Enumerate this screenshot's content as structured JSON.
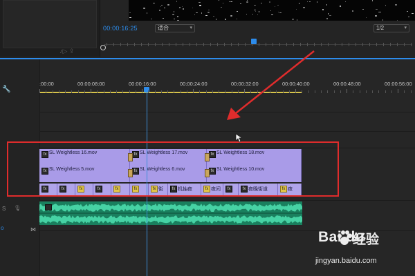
{
  "monitor": {
    "timecode": "00:00:16:25",
    "fit_label": "适合",
    "resolution_label": "1/2"
  },
  "timeline": {
    "ruler_labels": [
      ":00:00",
      "00:00:08:00",
      "00:00:16:00",
      "00:00:24:00",
      "00:00:32:00",
      "00:00:40:00",
      "00:00:48:00",
      "00:00:56:00"
    ],
    "track_label_s": "S",
    "track_label_o": "o"
  },
  "clips": {
    "v2": [
      {
        "name": "SL Weightless 16.mov"
      },
      {
        "name": "SL Weightless 17.mov"
      },
      {
        "name": "SL Weightless 18.mov"
      }
    ],
    "v1": [
      {
        "name": "SL Weightless 5.mov"
      },
      {
        "name": "SL Weightless 6.mov"
      },
      {
        "name": "SL Weightless 10.mov"
      }
    ],
    "text_clips": [
      {
        "name": ""
      },
      {
        "name": ""
      },
      {
        "name": ""
      },
      {
        "name": ""
      },
      {
        "name": ""
      },
      {
        "name": ""
      },
      {
        "name": "街"
      },
      {
        "name": "机抽夜"
      },
      {
        "name": "夜间"
      },
      {
        "name": ""
      },
      {
        "name": "夜晚街道"
      },
      {
        "name": "夜"
      }
    ]
  },
  "watermark": {
    "brand": "Bai du",
    "product": "经验",
    "url": "jingyan.baidu.com"
  },
  "colors": {
    "accent_blue": "#2d8ceb",
    "clip_purple": "#a99be8",
    "audio_green": "#1a7f5e",
    "annotation_red": "#e02c2c"
  }
}
